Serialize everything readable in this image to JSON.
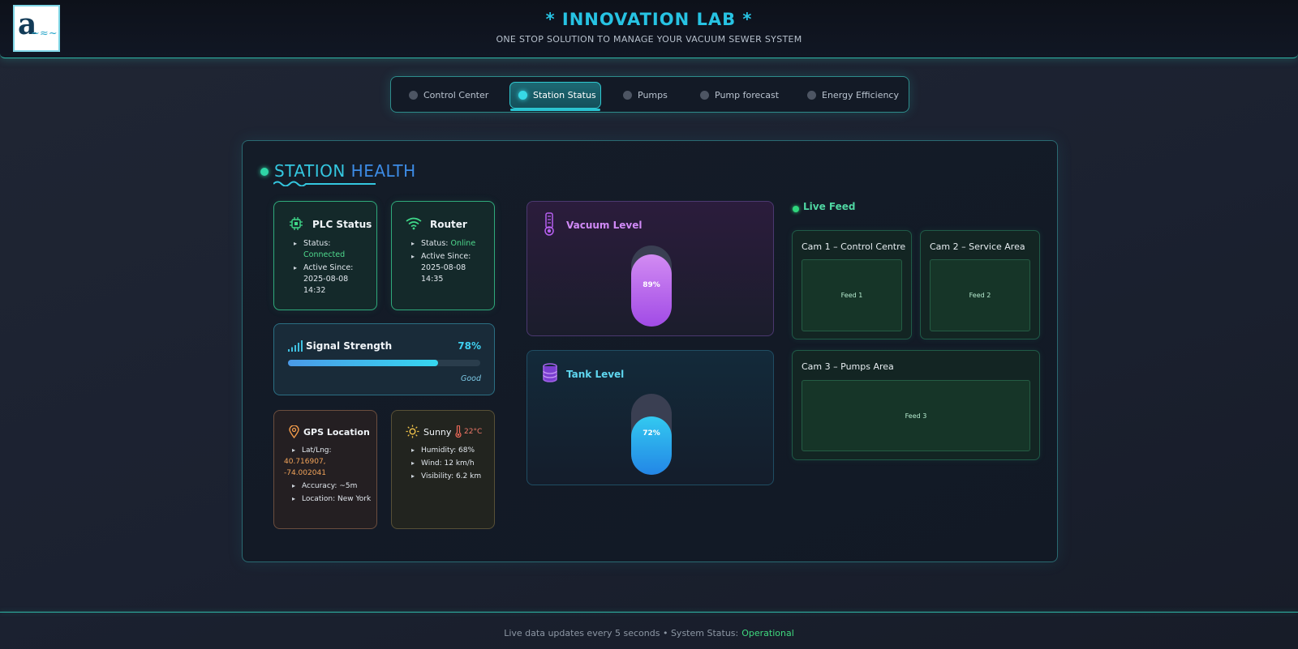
{
  "header": {
    "title": "* INNOVATION LAB *",
    "subtitle": "ONE STOP SOLUTION TO MANAGE YOUR VACUUM SEWER SYSTEM",
    "logo_icon": "wave-letter-a-logo"
  },
  "tabs": [
    {
      "label": "Control Center",
      "active": false
    },
    {
      "label": "Station Status",
      "active": true
    },
    {
      "label": "Pumps",
      "active": false
    },
    {
      "label": "Pump forecast",
      "active": false
    },
    {
      "label": "Energy Efficiency",
      "active": false
    }
  ],
  "section": {
    "title_part1": "STATION ",
    "title_part2": "HEALTH"
  },
  "plc": {
    "title": "PLC Status",
    "icon": "chip-icon",
    "status_label": "Status:",
    "status_value": "Connected",
    "active_label": "Active Since:",
    "active_value": "2025-08-08 14:32"
  },
  "router": {
    "title": "Router",
    "icon": "wifi-icon",
    "status_label": "Status:",
    "status_value": "Online",
    "active_label": "Active Since:",
    "active_value": "2025-08-08 14:35"
  },
  "signal": {
    "title": "Signal Strength",
    "icon": "signal-bars-icon",
    "percent_text": "78%",
    "value": 0.78,
    "quality": "Good"
  },
  "gps": {
    "title": "GPS Location",
    "icon": "map-pin-icon",
    "latlng_label": "Lat/Lng:",
    "latlng_value": "40.716907, -74.002041",
    "accuracy": "Accuracy: ~5m",
    "location": "Location: New York"
  },
  "weather": {
    "title": "Sunny",
    "icon": "sun-icon",
    "temp_icon": "thermometer-icon",
    "temperature": "22°C",
    "humidity": "Humidity: 68%",
    "wind": "Wind: 12 km/h",
    "visibility": "Visibility: 6.2 km"
  },
  "vacuum": {
    "title": "Vacuum Level",
    "icon": "gauge-thermometer-icon",
    "percent_text": "89%",
    "value": 0.89
  },
  "tank": {
    "title": "Tank Level",
    "icon": "database-icon",
    "percent_text": "72%",
    "value": 0.72
  },
  "live_feed": {
    "title": "Live Feed",
    "cams": [
      {
        "title": "Cam 1 – Control Centre",
        "feed": "Feed 1"
      },
      {
        "title": "Cam 2 – Service Area",
        "feed": "Feed 2"
      },
      {
        "title": "Cam 3 – Pumps Area",
        "feed": "Feed 3"
      }
    ]
  },
  "footer": {
    "text": "Live data updates every 5 seconds • System Status:",
    "status": "Operational"
  },
  "colors": {
    "accent": "#27c3e3",
    "operational": "#3fd97e",
    "vacuum": "#b65ff0",
    "tank": "#2fb6ef"
  }
}
